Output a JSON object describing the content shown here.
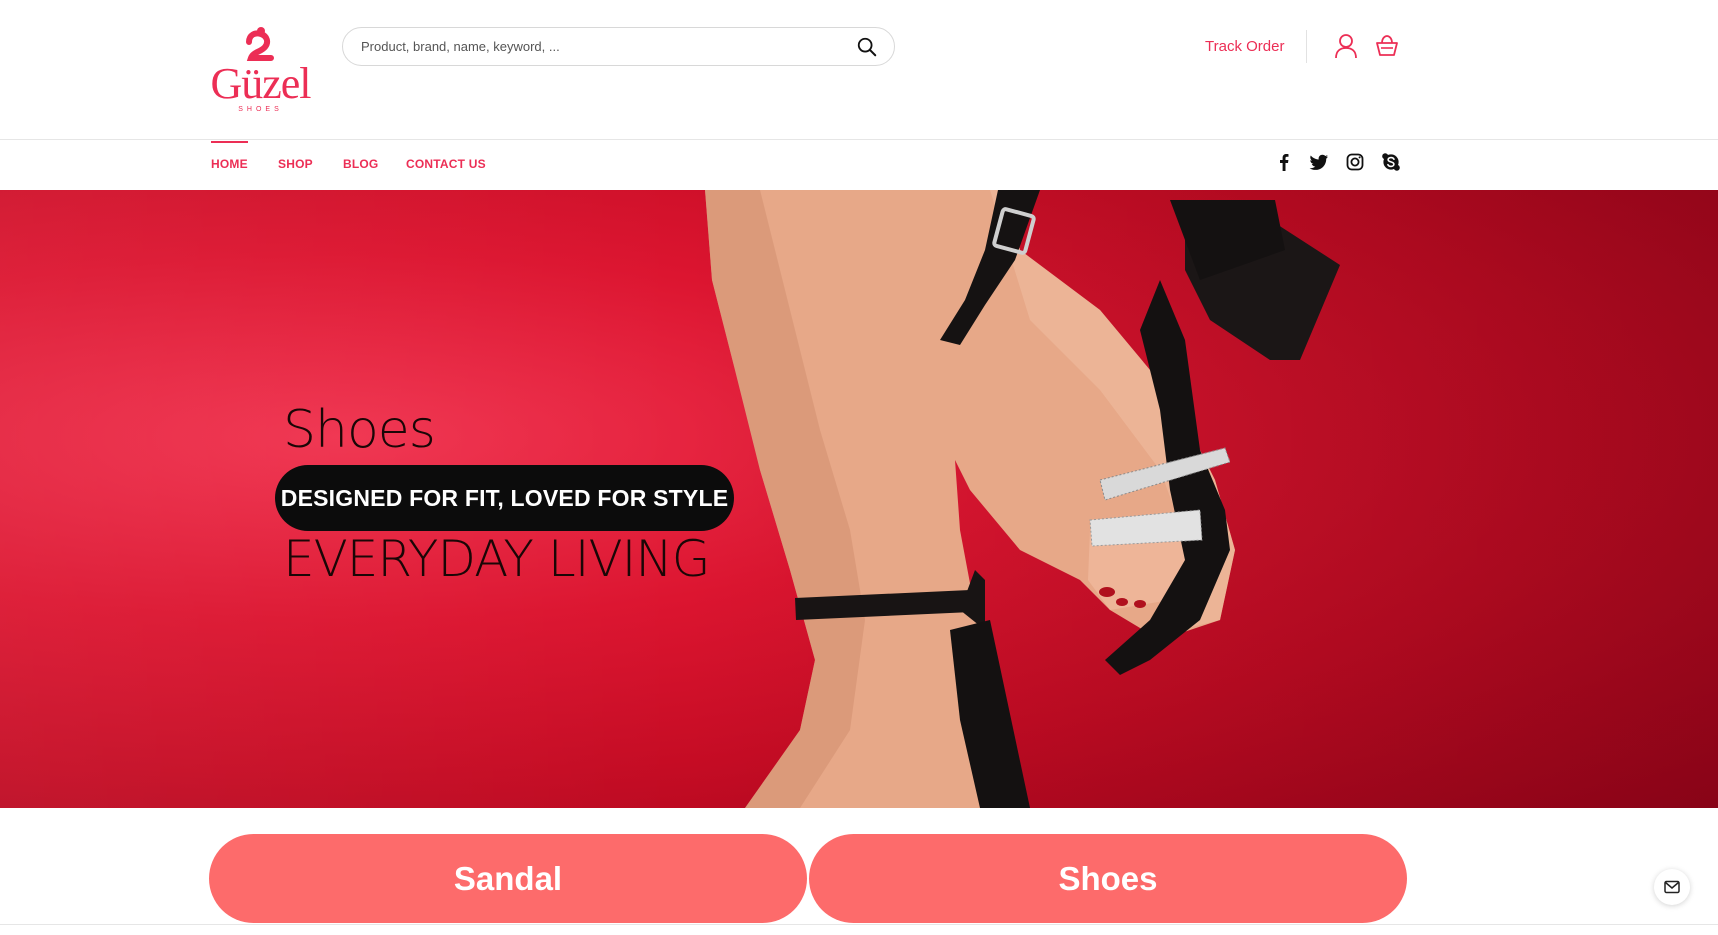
{
  "brand": {
    "logo_text": "Güzel",
    "logo_sub": "SHOES",
    "color": "#ec2e55"
  },
  "search": {
    "placeholder": "Product, brand, name, keyword, ...",
    "icon": "search-icon"
  },
  "header": {
    "track_order": "Track Order",
    "user_icon": "user-icon",
    "cart_icon": "basket-icon"
  },
  "nav": {
    "items": [
      {
        "label": "HOME",
        "active": true
      },
      {
        "label": "SHOP",
        "active": false
      },
      {
        "label": "BLOG",
        "active": false
      },
      {
        "label": "CONTACT US",
        "active": false
      }
    ],
    "social": [
      "facebook-icon",
      "twitter-icon",
      "instagram-icon",
      "skype-icon"
    ]
  },
  "hero": {
    "line1": "Shoes",
    "pill": "DESIGNED FOR FIT, LOVED FOR STYLE",
    "line3": "EVERYDAY LIVING",
    "background_color": "#d3112b"
  },
  "categories": [
    {
      "label": "Sandal"
    },
    {
      "label": "Shoes"
    }
  ],
  "category_color": "#fd6b6b",
  "floating": {
    "icon": "mail-icon"
  }
}
